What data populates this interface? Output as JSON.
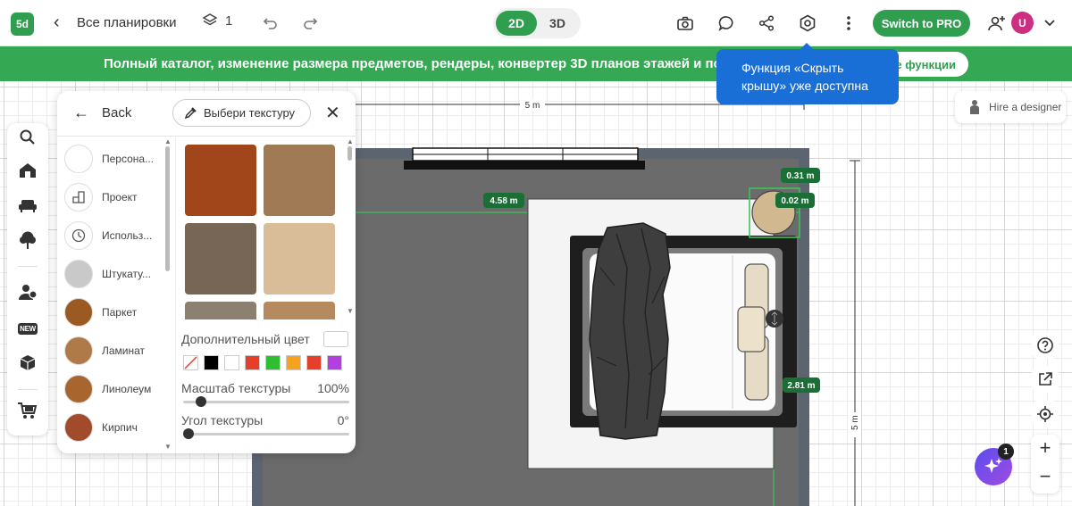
{
  "app": {
    "logo_text": "5d"
  },
  "header": {
    "plans_link": "Все планировки",
    "floors_count": "1",
    "view_toggle": [
      {
        "label": "2D",
        "active": true
      },
      {
        "label": "3D",
        "active": false
      }
    ],
    "pro_button": "Switch to PRO",
    "avatar_initial": "U",
    "icons": [
      "back-arrow-icon",
      "layers-icon",
      "undo-icon",
      "redo-icon",
      "camera-icon",
      "comment-icon",
      "share-icon",
      "settings-icon",
      "more-vertical-icon",
      "add-user-icon",
      "chevron-down-icon"
    ]
  },
  "banner": {
    "text": "Полный каталог, изменение размера предметов, рендеры, конвертер 3D планов этажей и помо",
    "button_label": "е функции",
    "color": "#34a853"
  },
  "tooltip": {
    "text": "Функция «Скрыть крышу» уже доступна",
    "color": "#1a6fd6"
  },
  "texture_panel": {
    "back_label": "Back",
    "choose_button": "Выбери текстуру",
    "categories": [
      {
        "label": "Персона...",
        "thumb": "#ffffff"
      },
      {
        "label": "Проект",
        "thumb": "project-icon"
      },
      {
        "label": "Использ...",
        "thumb": "clock-icon"
      },
      {
        "label": "Штукату...",
        "thumb": "#c9c9c9"
      },
      {
        "label": "Паркет",
        "thumb": "#9a5a22"
      },
      {
        "label": "Ламинат",
        "thumb": "#b07a48"
      },
      {
        "label": "Линолеум",
        "thumb": "#a8662e"
      },
      {
        "label": "Кирпич",
        "thumb": "#a14b2c"
      }
    ],
    "textures": [
      "#a0461a",
      "#a07a55",
      "#776655",
      "#d9bc98",
      "#8c8070",
      "#b58a5e"
    ],
    "extra_color_label": "Дополнительный цвет",
    "swatches": [
      "none",
      "#000000",
      "#ffffff",
      "#e53e2b",
      "#2fbe2f",
      "#f5a21e",
      "#e53e2b",
      "#b43fe0"
    ],
    "scale_label": "Масштаб текстуры",
    "scale_value": "100%",
    "scale_level": 0.08,
    "angle_label": "Угол текстуры",
    "angle_value": "0°",
    "angle_level": 0
  },
  "floor_plan": {
    "top_dimension": "5 m",
    "side_dimension": "5 m",
    "labels": {
      "a": "4.58 m",
      "b": "0.31 m",
      "c": "0.02 m",
      "d": "2.81 m"
    },
    "floor_color": "#6b6b6b",
    "wall_color": "#5c6470"
  },
  "right_tools": {
    "hire_label": "Hire a designer",
    "ai_badge": "1",
    "zoom_in": "+",
    "zoom_out": "−"
  }
}
